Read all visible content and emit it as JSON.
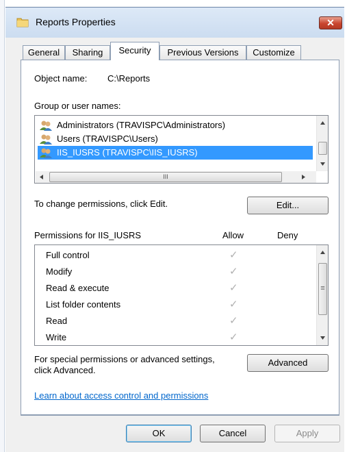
{
  "window": {
    "title": "Reports Properties",
    "close_label": "✕"
  },
  "tabs": [
    {
      "label": "General"
    },
    {
      "label": "Sharing"
    },
    {
      "label": "Security"
    },
    {
      "label": "Previous Versions"
    },
    {
      "label": "Customize"
    }
  ],
  "object": {
    "label": "Object name:",
    "value": "C:\\Reports"
  },
  "groups": {
    "label": "Group or user names:",
    "items": [
      {
        "label": "Administrators (TRAVISPC\\Administrators)",
        "selected": false
      },
      {
        "label": "Users (TRAVISPC\\Users)",
        "selected": false
      },
      {
        "label": "IIS_IUSRS (TRAVISPC\\IIS_IUSRS)",
        "selected": true
      }
    ],
    "hscroll_grip": "III"
  },
  "edit": {
    "hint": "To change permissions, click Edit.",
    "button": "Edit..."
  },
  "permissions": {
    "header": "Permissions for IIS_IUSRS",
    "allow_header": "Allow",
    "deny_header": "Deny",
    "rows": [
      {
        "label": "Full control",
        "allow": "✓"
      },
      {
        "label": "Modify",
        "allow": "✓"
      },
      {
        "label": "Read & execute",
        "allow": "✓"
      },
      {
        "label": "List folder contents",
        "allow": "✓"
      },
      {
        "label": "Read",
        "allow": "✓"
      },
      {
        "label": "Write",
        "allow": "✓"
      }
    ],
    "vscroll_grip": "≡"
  },
  "advanced": {
    "hint_line1": "For special permissions or advanced settings,",
    "hint_line2": "click Advanced.",
    "button": "Advanced"
  },
  "learn_link": "Learn about access control and permissions",
  "footer": {
    "ok": "OK",
    "cancel": "Cancel",
    "apply": "Apply"
  },
  "colors": {
    "selection": "#3399ff",
    "link": "#0066cc",
    "close": "#c9452f"
  }
}
